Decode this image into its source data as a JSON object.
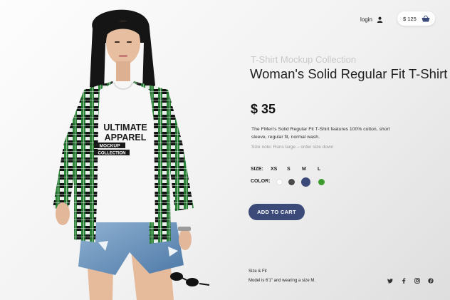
{
  "header": {
    "login_label": "login",
    "login_icon": "user-icon",
    "cart_amount": "$ 125",
    "cart_icon": "basket-icon"
  },
  "tshirt_print": {
    "line1": "ULTIMATE",
    "line2": "APPAREL",
    "line3": "MOCKUP",
    "line4": "COLLECTION"
  },
  "product": {
    "collection": "T-Shirt Mockup Collection",
    "title": "Woman's Solid Regular Fit T-Shirt",
    "price": "$ 35",
    "description": "The FMen's Solid Regular Fit T-Shirt features 100% cotton, short sleeve, regular fit, normal wash.",
    "size_note": "Size note: Runs large – order size down"
  },
  "options": {
    "size_label": "SIZE:",
    "sizes": [
      "XS",
      "S",
      "M",
      "L"
    ],
    "selected_size": "M",
    "color_label": "COLOR:",
    "colors": [
      "#ffffff",
      "#4a4a4a",
      "#3b4a78",
      "#3d9a2c"
    ],
    "selected_color": "#3b4a78"
  },
  "actions": {
    "add_to_cart": "ADD TO CART"
  },
  "fit": {
    "heading": "Size & Fit",
    "text": "Model is 6'1\" and wearing a size M."
  },
  "social": [
    "twitter-icon",
    "facebook-icon",
    "instagram-icon",
    "pinterest-icon"
  ],
  "colors": {
    "accent": "#3b4a78",
    "muted_heading": "#c9c9c9"
  }
}
